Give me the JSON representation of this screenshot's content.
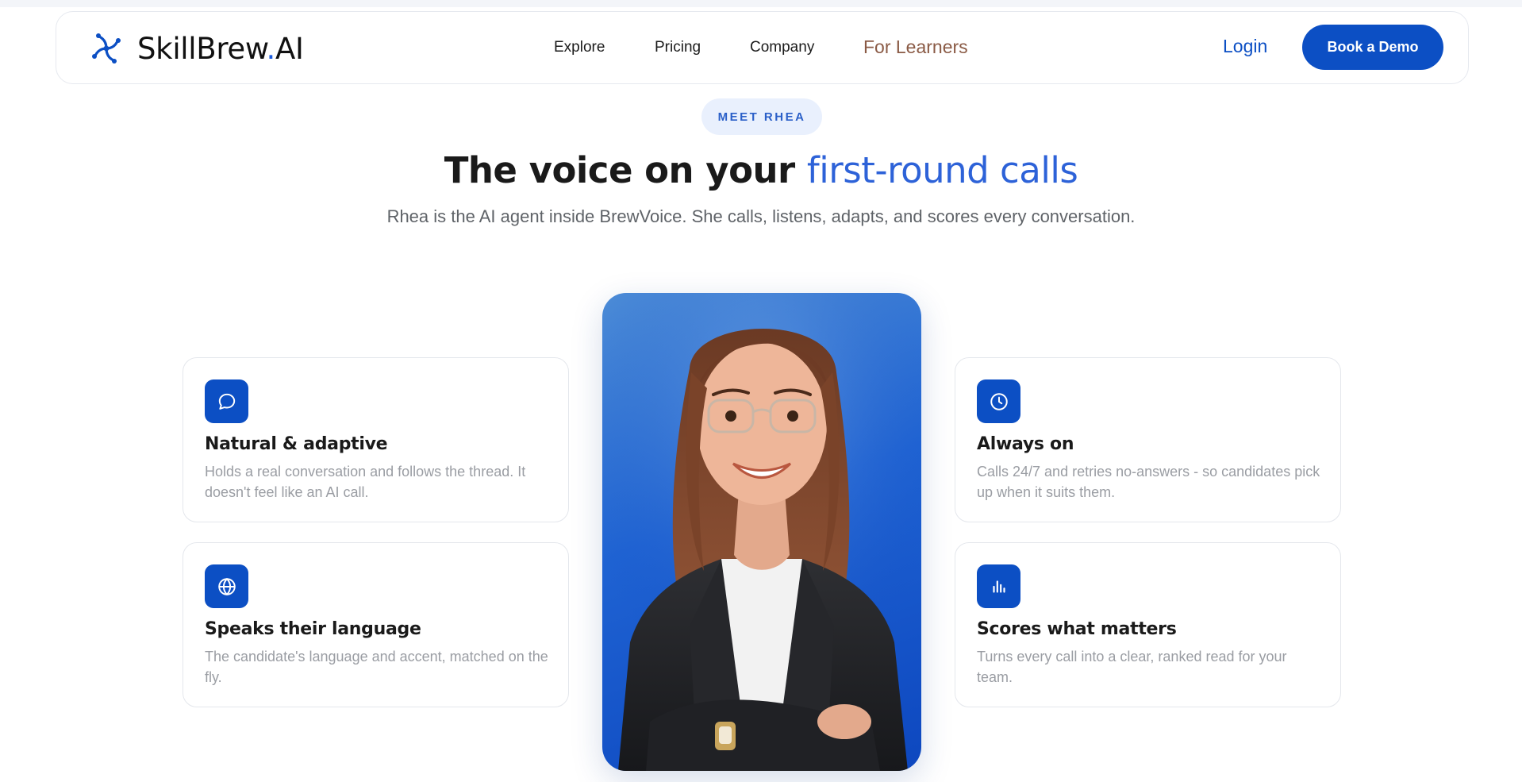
{
  "brand": {
    "name": "SkillBrew",
    "dot": ".",
    "suffix": "AI"
  },
  "nav": {
    "explore": "Explore",
    "pricing": "Pricing",
    "company": "Company",
    "learners": "For Learners",
    "login": "Login",
    "demo": "Book a Demo"
  },
  "hero": {
    "pill": "MEET RHEA",
    "headline_start": "The voice on your ",
    "headline_accent": "first-round calls",
    "subhead": "Rhea is the AI agent inside BrewVoice. She calls, listens, adapts, and scores every conversation."
  },
  "features": [
    {
      "icon": "chat-bubble-icon",
      "title": "Natural & adaptive",
      "desc": "Holds a real conversation and follows the thread. It doesn't feel like an AI call."
    },
    {
      "icon": "globe-icon",
      "title": "Speaks their language",
      "desc": "The candidate's language and accent, matched on the fly."
    },
    {
      "icon": "clock-icon",
      "title": "Always on",
      "desc": "Calls 24/7 and retries no-answers - so candidates pick up when it suits them."
    },
    {
      "icon": "bar-chart-icon",
      "title": "Scores what matters",
      "desc": "Turns every call into a clear, ranked read for your team."
    }
  ],
  "colors": {
    "accent": "#0c4fc4",
    "headline_accent": "#2d62d8",
    "learners_link": "#8a5a45"
  }
}
